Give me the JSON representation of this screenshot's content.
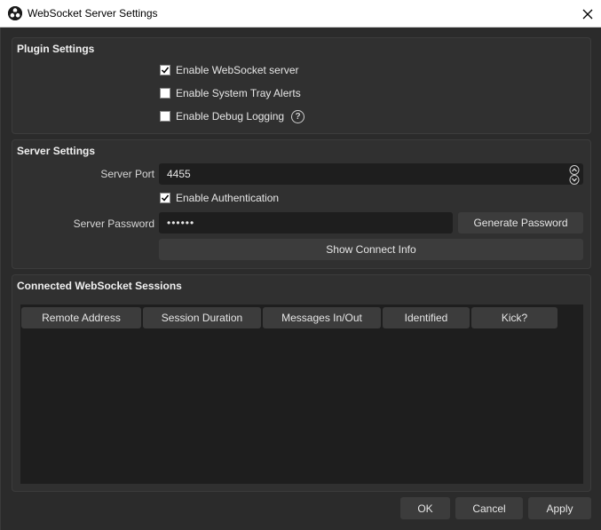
{
  "window": {
    "title": "WebSocket Server Settings",
    "icon": "obs-logo-icon",
    "close_icon": "close-icon"
  },
  "plugin_settings": {
    "title": "Plugin Settings",
    "enable_server": {
      "label": "Enable WebSocket server",
      "checked": true
    },
    "tray_alerts": {
      "label": "Enable System Tray Alerts",
      "checked": false
    },
    "debug_logging": {
      "label": "Enable Debug Logging",
      "checked": false,
      "help_icon": "?"
    }
  },
  "server_settings": {
    "title": "Server Settings",
    "port_label": "Server Port",
    "port_value": "4455",
    "auth": {
      "label": "Enable Authentication",
      "checked": true
    },
    "password_label": "Server Password",
    "password_value": "••••••",
    "generate_label": "Generate Password",
    "show_connect_label": "Show Connect Info"
  },
  "sessions": {
    "title": "Connected WebSocket Sessions",
    "columns": [
      "Remote Address",
      "Session Duration",
      "Messages In/Out",
      "Identified",
      "Kick?"
    ],
    "rows": []
  },
  "footer": {
    "ok_label": "OK",
    "cancel_label": "Cancel",
    "apply_label": "Apply"
  },
  "colors": {
    "background": "#2b2b2b",
    "group": "#303030",
    "field": "#1e1e1e",
    "button": "#3c3c3c"
  }
}
